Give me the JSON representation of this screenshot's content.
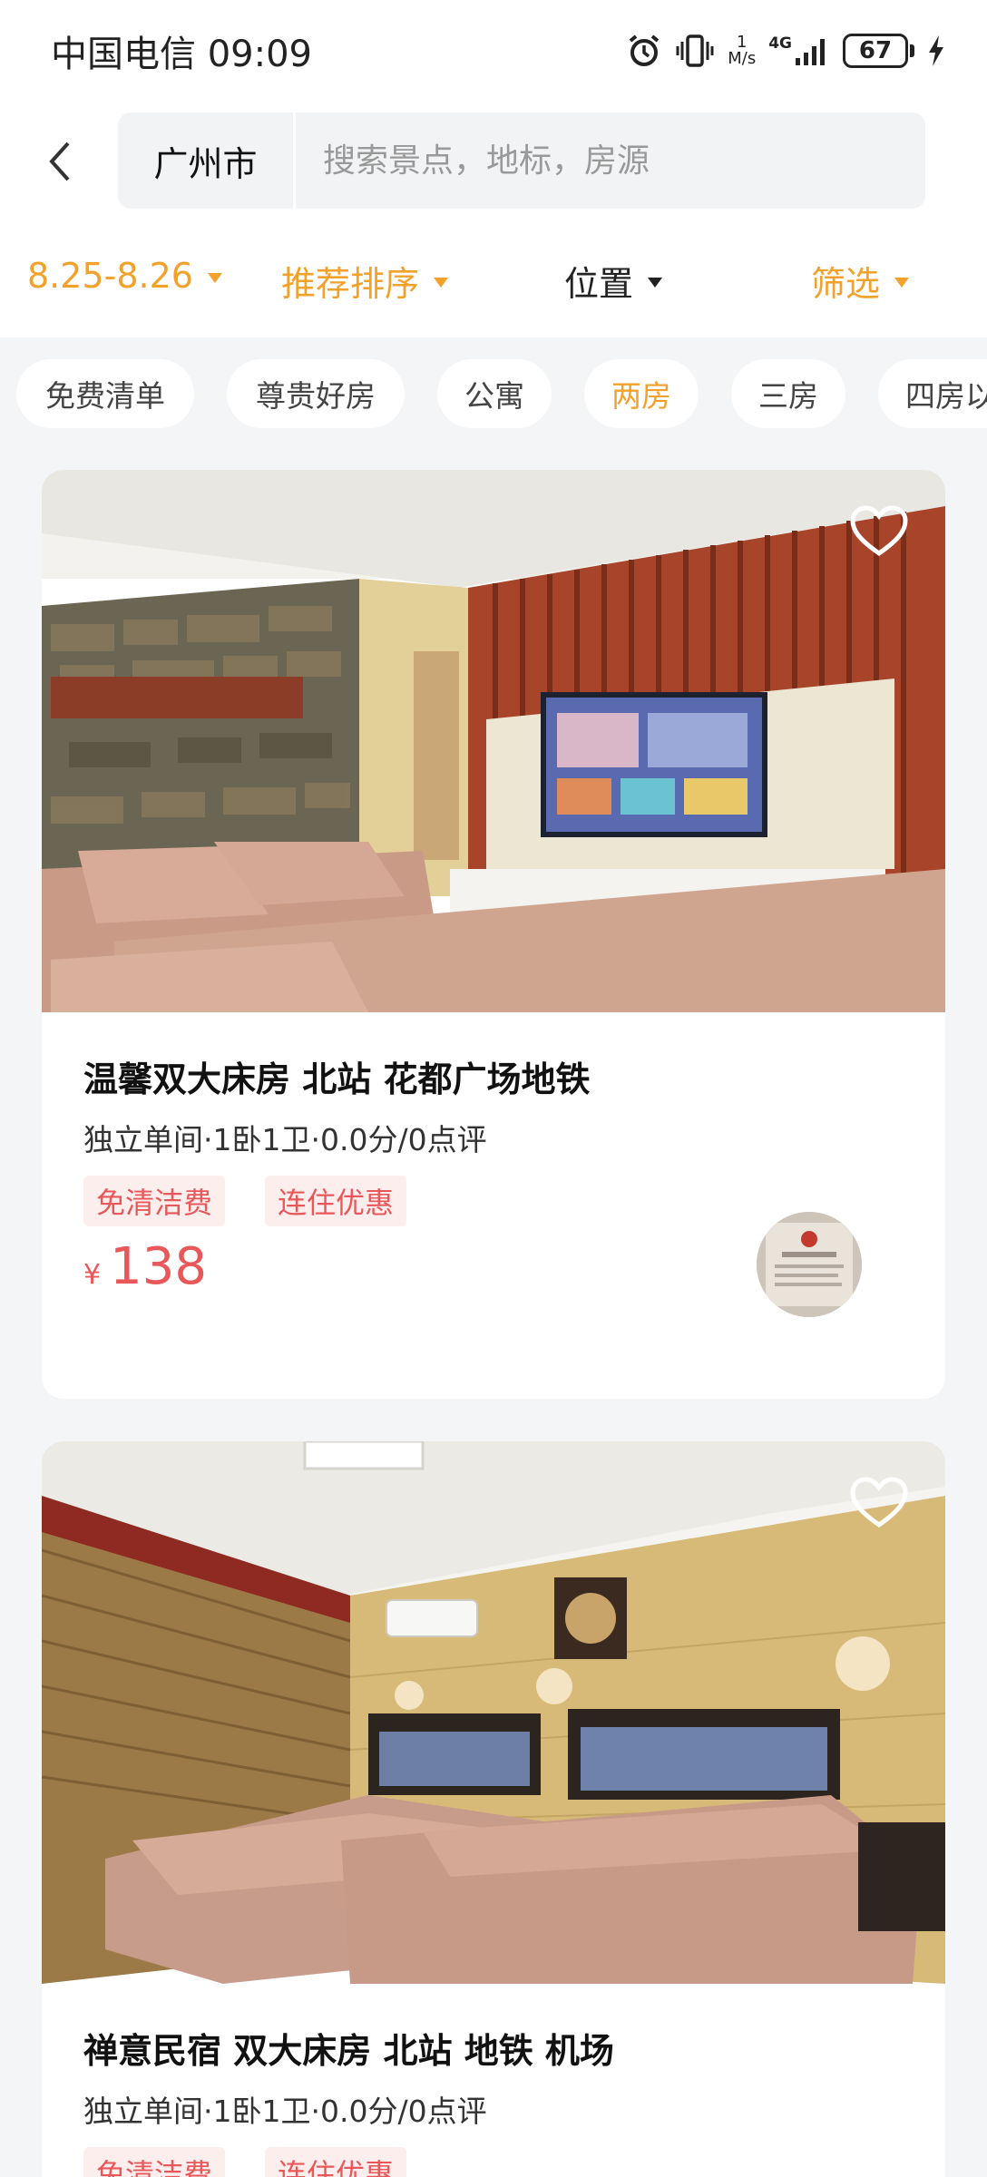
{
  "status_bar": {
    "carrier_time": "中国电信 09:09",
    "net_speed_value": "1",
    "net_speed_unit": "M/s",
    "network": "4G",
    "battery": "67",
    "icons": [
      "alarm-icon",
      "vibrate-icon",
      "signal-icon",
      "battery-icon",
      "charging-icon"
    ]
  },
  "search": {
    "city": "广州市",
    "placeholder": "搜索景点，地标，房源"
  },
  "filters": {
    "dates": "8.25-8.26",
    "sort": "推荐排序",
    "location": "位置",
    "filter": "筛选"
  },
  "chips": [
    "免费清单",
    "尊贵好房",
    "公寓",
    "两房",
    "三房",
    "四房以"
  ],
  "active_chip": "两房",
  "listings": [
    {
      "title": "温馨双大床房 北站 花都广场地铁",
      "meta": "独立单间·1卧1卫·0.0分/0点评",
      "tags": [
        "免清洁费",
        "连住优惠"
      ],
      "currency": "¥",
      "price": "138"
    },
    {
      "title": "禅意民宿 双大床房  北站 地铁 机场",
      "meta": "独立单间·1卧1卫·0.0分/0点评",
      "tags": [
        "免清洁费",
        "连住优惠"
      ]
    }
  ],
  "colors": {
    "accent_orange": "#f2a12b",
    "price_red": "#e8585a",
    "tag_bg": "#fdeeee",
    "page_bg": "#f4f5f7"
  }
}
